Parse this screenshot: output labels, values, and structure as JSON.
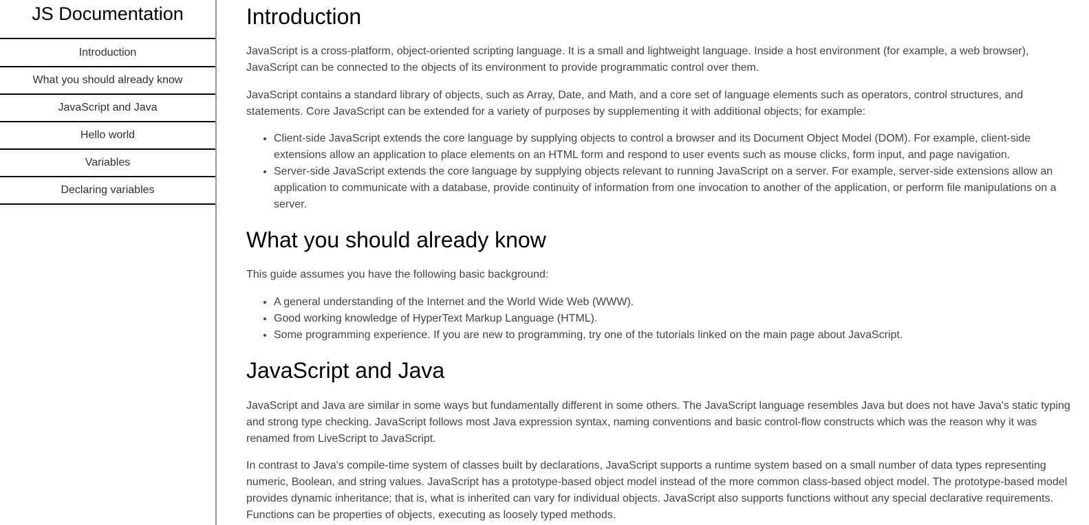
{
  "navbar": {
    "title": "JS Documentation",
    "items": [
      {
        "label": "Introduction"
      },
      {
        "label": "What you should already know"
      },
      {
        "label": "JavaScript and Java"
      },
      {
        "label": "Hello world"
      },
      {
        "label": "Variables"
      },
      {
        "label": "Declaring variables"
      }
    ]
  },
  "sections": {
    "introduction": {
      "heading": "Introduction",
      "paragraphs": [
        "JavaScript is a cross-platform, object-oriented scripting language. It is a small and lightweight language. Inside a host environment (for example, a web browser), JavaScript can be connected to the objects of its environment to provide programmatic control over them.",
        "JavaScript contains a standard library of objects, such as Array, Date, and Math, and a core set of language elements such as operators, control structures, and statements. Core JavaScript can be extended for a variety of purposes by supplementing it with additional objects; for example:"
      ],
      "list": [
        "Client-side JavaScript extends the core language by supplying objects to control a browser and its Document Object Model (DOM). For example, client-side extensions allow an application to place elements on an HTML form and respond to user events such as mouse clicks, form input, and page navigation.",
        "Server-side JavaScript extends the core language by supplying objects relevant to running JavaScript on a server. For example, server-side extensions allow an application to communicate with a database, provide continuity of information from one invocation to another of the application, or perform file manipulations on a server."
      ]
    },
    "what_you_should_know": {
      "heading": "What you should already know",
      "paragraphs": [
        "This guide assumes you have the following basic background:"
      ],
      "list": [
        "A general understanding of the Internet and the World Wide Web (WWW).",
        "Good working knowledge of HyperText Markup Language (HTML).",
        "Some programming experience. If you are new to programming, try one of the tutorials linked on the main page about JavaScript."
      ]
    },
    "javascript_and_java": {
      "heading": "JavaScript and Java",
      "paragraphs": [
        "JavaScript and Java are similar in some ways but fundamentally different in some others. The JavaScript language resembles Java but does not have Java's static typing and strong type checking. JavaScript follows most Java expression syntax, naming conventions and basic control-flow constructs which was the reason why it was renamed from LiveScript to JavaScript.",
        "In contrast to Java's compile-time system of classes built by declarations, JavaScript supports a runtime system based on a small number of data types representing numeric, Boolean, and string values. JavaScript has a prototype-based object model instead of the more common class-based object model. The prototype-based model provides dynamic inheritance; that is, what is inherited can vary for individual objects. JavaScript also supports functions without any special declarative requirements. Functions can be properties of objects, executing as loosely typed methods."
      ]
    }
  }
}
